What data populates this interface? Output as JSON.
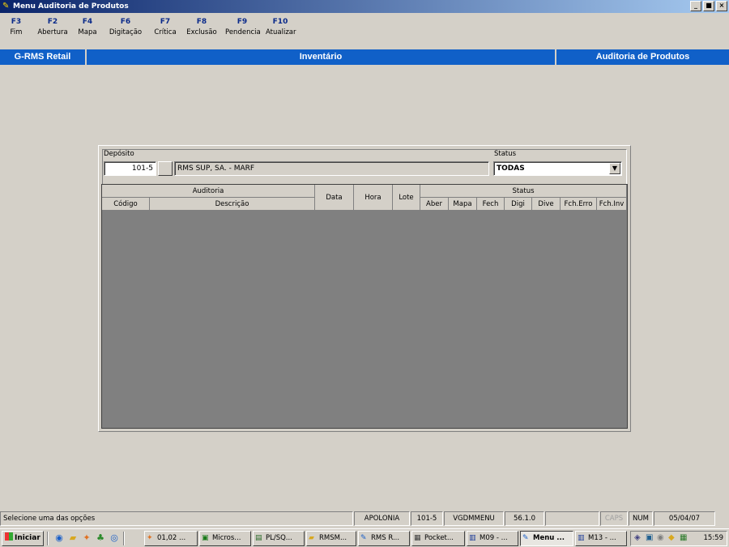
{
  "window": {
    "title": "Menu Auditoria de Produtos",
    "controls": [
      "_",
      "■",
      "×"
    ]
  },
  "fkeys": [
    {
      "key": "F3",
      "label": "Fim"
    },
    {
      "key": "F2",
      "label": "Abertura"
    },
    {
      "key": "F4",
      "label": "Mapa"
    },
    {
      "key": "F6",
      "label": "Digitação"
    },
    {
      "key": "F7",
      "label": "Crítica"
    },
    {
      "key": "F8",
      "label": "Exclusão"
    },
    {
      "key": "F9",
      "label": "Pendencia"
    },
    {
      "key": "F10",
      "label": "Atualizar"
    }
  ],
  "header": {
    "left": "G-RMS Retail",
    "center": "Inventário",
    "right": "Auditoria de Produtos"
  },
  "filter": {
    "deposito_label": "Depósito",
    "deposito_code": "101-5",
    "deposito_name": "RMS SUP, SA. - MARF",
    "status_label": "Status",
    "status_value": "TODAS"
  },
  "grid": {
    "group_auditoria": "Auditoria",
    "group_status": "Status",
    "col_codigo": "Código",
    "col_descricao": "Descrição",
    "col_data": "Data",
    "col_hora": "Hora",
    "col_lote": "Lote",
    "status_cols": [
      "Aber",
      "Mapa",
      "Fech",
      "Digi",
      "Dive",
      "Fch.Erro",
      "Fch.Inv"
    ],
    "rows": []
  },
  "statusbar": {
    "message": "Selecione uma das opções",
    "user": "APOLONIA",
    "store": "101-5",
    "db": "VGDMMENU",
    "version": "56.1.0",
    "empty": "",
    "caps": "CAPS",
    "num": "NUM",
    "date": "05/04/07"
  },
  "taskbar": {
    "start_label": "Iniciar",
    "tasks": [
      "01,02 ...",
      "Micros...",
      "PL/SQ...",
      "RMSM...",
      "RMS R...",
      "Pocket...",
      "M09 - ...",
      "Menu ...",
      "M13 - ..."
    ],
    "active_task": "Menu ...",
    "clock": "15:59"
  }
}
